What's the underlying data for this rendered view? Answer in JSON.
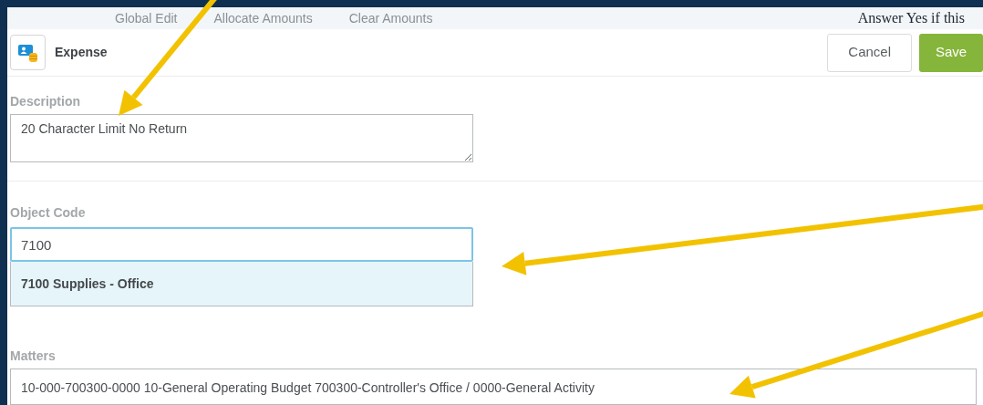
{
  "top_tabs": [
    "Global Edit",
    "Allocate Amounts",
    "Clear Amounts"
  ],
  "background_text": "Answer Yes if this",
  "header": {
    "title": "Expense",
    "buttons": [
      {
        "label": "Cancel",
        "kind": "secondary"
      },
      {
        "label": "Save",
        "kind": "primary"
      }
    ]
  },
  "description": {
    "label": "Description",
    "value": "20 Character Limit No Return"
  },
  "object_code": {
    "label": "Object Code",
    "value": "7100",
    "focused": true,
    "suggestions": [
      {
        "label": "7100 Supplies - Office",
        "selected": true
      }
    ]
  },
  "matters": {
    "label": "Matters",
    "value": "10-000-700300-0000 10-General Operating Budget 700300-Controller's Office / 0000-General Activity"
  }
}
